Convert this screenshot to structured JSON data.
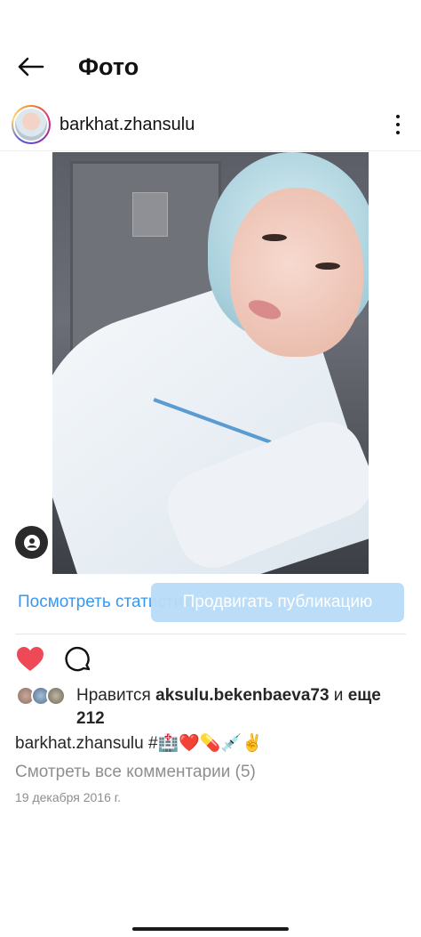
{
  "header": {
    "title": "Фото"
  },
  "post": {
    "username": "barkhat.zhansulu",
    "stats_link": "Посмотреть статистику",
    "promote_button": "Продвигать публикацию",
    "likes": {
      "prefix": "Нравится ",
      "user": "aksulu.bekenbaeva73",
      "middle": " и ",
      "others": "еще 212"
    },
    "caption": {
      "username": "barkhat.zhansulu",
      "text": " #🏥❤️💊💉✌️"
    },
    "view_comments": "Смотреть все комментарии (5)",
    "date": "19 декабря 2016 г."
  },
  "colors": {
    "link_blue": "#3897f0",
    "promote_bg": "#b9dcf7",
    "like_red": "#ed4956",
    "muted_text": "#8e8e8e"
  },
  "icons": [
    "back-arrow-icon",
    "more-vertical-icon",
    "person-tag-icon",
    "heart-filled-icon",
    "comment-icon"
  ]
}
